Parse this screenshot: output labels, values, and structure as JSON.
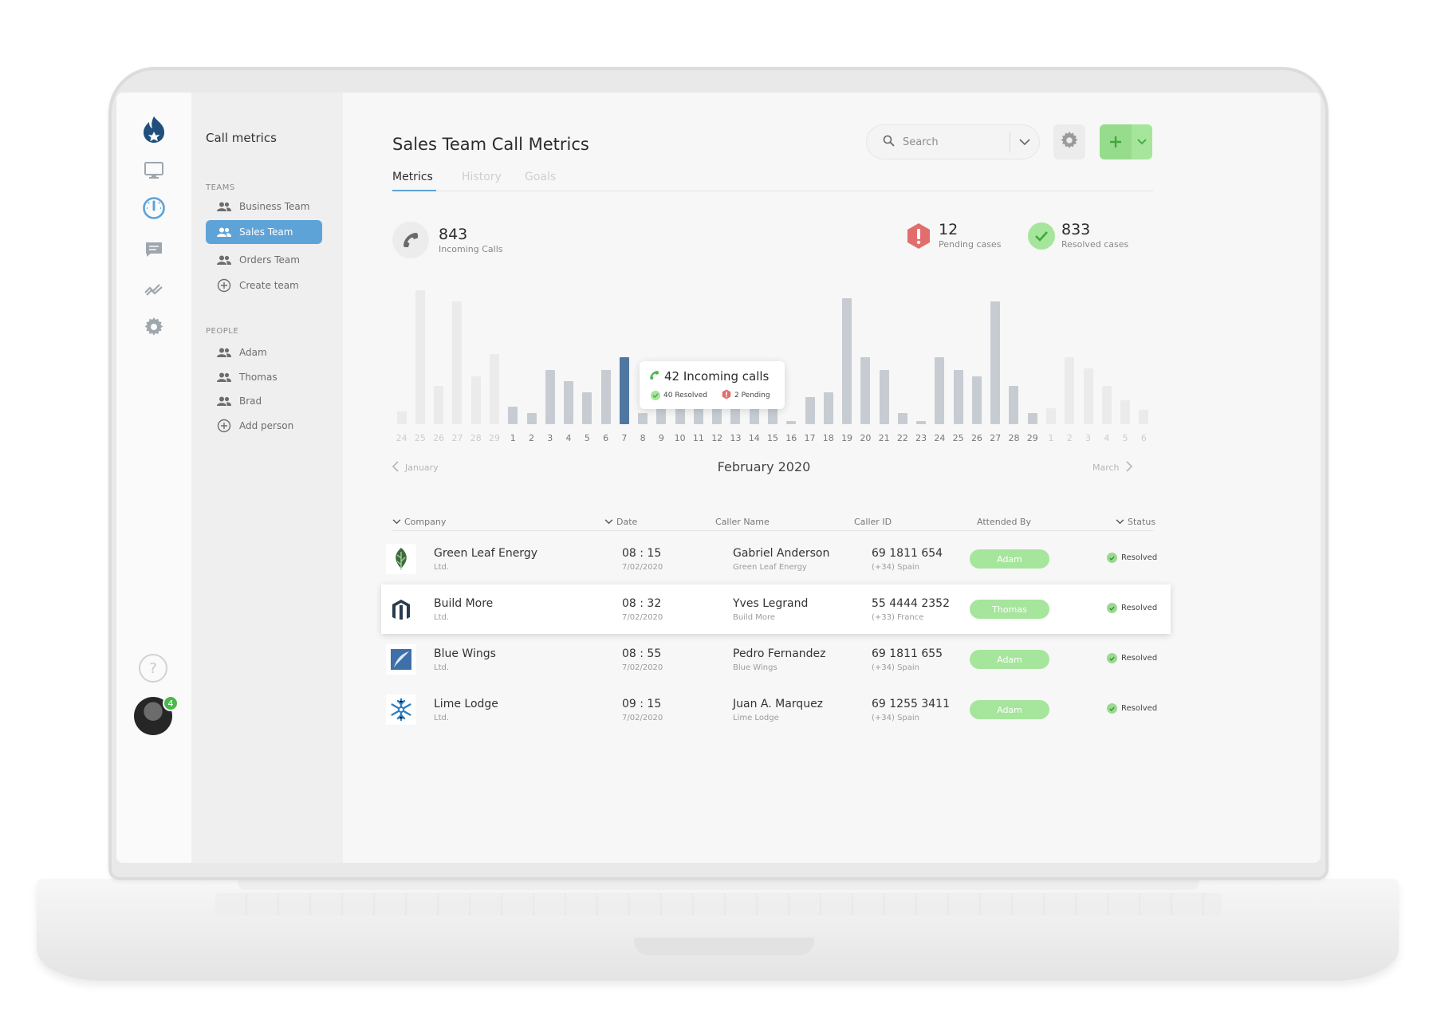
{
  "sidebar": {
    "title": "Call metrics",
    "teams_section": "TEAMS",
    "teams": [
      "Business Team",
      "Sales Team",
      "Orders Team"
    ],
    "create_team": "Create team",
    "people_section": "PEOPLE",
    "people": [
      "Adam",
      "Thomas",
      "Brad"
    ],
    "add_person": "Add person"
  },
  "rail": {
    "icons": [
      "flame-logo-icon",
      "monitor-icon",
      "gauge-icon",
      "chat-icon",
      "trend-icon",
      "gear-icon"
    ],
    "help": "?",
    "notification_count": "4"
  },
  "header": {
    "title": "Sales Team Call Metrics",
    "search_placeholder": "Search",
    "add_symbol": "+"
  },
  "tabs": [
    "Metrics",
    "History",
    "Goals"
  ],
  "kpis": {
    "incoming": {
      "value": "843",
      "label": "Incoming Calls"
    },
    "pending": {
      "value": "12",
      "label": "Pending cases"
    },
    "resolved": {
      "value": "833",
      "label": "Resolved cases"
    }
  },
  "colors": {
    "accent": "#5ea3d8",
    "selected_bar": "#4f77a2",
    "current_bar": "#c7ccd3",
    "outside_bar": "#ebebeb",
    "success": "#a6e59c",
    "danger": "#e26d6d"
  },
  "chart_data": {
    "type": "bar",
    "categories": [
      "24",
      "25",
      "26",
      "27",
      "28",
      "29",
      "1",
      "2",
      "3",
      "4",
      "5",
      "6",
      "7",
      "8",
      "9",
      "10",
      "11",
      "12",
      "13",
      "14",
      "15",
      "16",
      "17",
      "18",
      "19",
      "20",
      "21",
      "22",
      "23",
      "24",
      "25",
      "26",
      "27",
      "28",
      "29",
      "1",
      "2",
      "3",
      "4",
      "5",
      "6"
    ],
    "in_month": [
      false,
      false,
      false,
      false,
      false,
      false,
      true,
      true,
      true,
      true,
      true,
      true,
      true,
      true,
      true,
      true,
      true,
      true,
      true,
      true,
      true,
      true,
      true,
      true,
      true,
      true,
      true,
      true,
      true,
      true,
      true,
      true,
      true,
      true,
      true,
      false,
      false,
      false,
      false,
      false,
      false
    ],
    "values": [
      8,
      84,
      24,
      77,
      30,
      44,
      11,
      7,
      34,
      27,
      20,
      34,
      42,
      7,
      10,
      28,
      20,
      24,
      26,
      20,
      28,
      2,
      17,
      20,
      79,
      42,
      34,
      7,
      2,
      42,
      34,
      30,
      77,
      24,
      7,
      10,
      42,
      35,
      24,
      15,
      9
    ],
    "selected_index": 12,
    "tooltip": {
      "title": "42 Incoming calls",
      "resolved": "40 Resolved",
      "pending": "2 Pending"
    },
    "month": "February 2020",
    "prev_month": "January",
    "next_month": "March"
  },
  "table": {
    "headers": [
      "Company",
      "Date",
      "Caller Name",
      "Caller ID",
      "Attended By",
      "Status"
    ],
    "rows": [
      {
        "company": "Green Leaf Energy",
        "company_sub": "Ltd.",
        "time": "08 : 15",
        "date": "7/02/2020",
        "caller": "Gabriel Anderson",
        "caller_sub": "Green Leaf Energy",
        "caller_id": "69 1811 654",
        "caller_loc": "(+34) Spain",
        "attended": "Adam",
        "status": "Resolved",
        "logo": "leaf-logo-icon"
      },
      {
        "company": "Build More",
        "company_sub": "Ltd.",
        "time": "08 : 32",
        "date": "7/02/2020",
        "caller": "Yves Legrand",
        "caller_sub": "Build More",
        "caller_id": "55 4444 2352",
        "caller_loc": "(+33) France",
        "attended": "Thomas",
        "status": "Resolved",
        "logo": "pillars-logo-icon"
      },
      {
        "company": "Blue Wings",
        "company_sub": "Ltd.",
        "time": "08 : 55",
        "date": "7/02/2020",
        "caller": "Pedro Fernandez",
        "caller_sub": "Blue Wings",
        "caller_id": "69 1811 655",
        "caller_loc": "(+34) Spain",
        "attended": "Adam",
        "status": "Resolved",
        "logo": "wing-logo-icon"
      },
      {
        "company": "Lime Lodge",
        "company_sub": "Ltd.",
        "time": "09 : 15",
        "date": "7/02/2020",
        "caller": "Juan A. Marquez",
        "caller_sub": "Lime Lodge",
        "caller_id": "69 1255 3411",
        "caller_loc": "(+34) Spain",
        "attended": "Adam",
        "status": "Resolved",
        "logo": "snowflake-logo-icon"
      }
    ]
  }
}
